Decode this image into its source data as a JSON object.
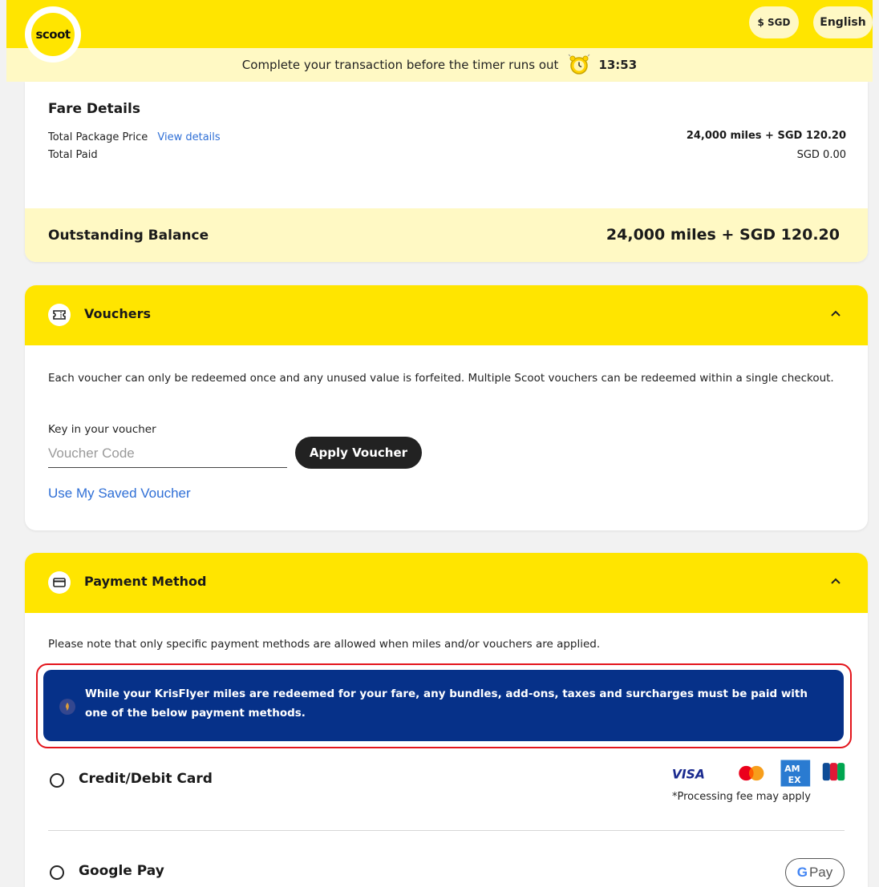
{
  "header": {
    "logo_text": "scoot",
    "currency": "$ SGD",
    "language": "English"
  },
  "timer": {
    "message": "Complete your transaction before the timer runs out",
    "value": "13:53"
  },
  "fare": {
    "title": "Fare Details",
    "package_label": "Total Package Price",
    "view_details": "View details",
    "package_value": "24,000 miles + SGD 120.20",
    "paid_label": "Total Paid",
    "paid_value": "SGD 0.00",
    "balance_label": "Outstanding Balance",
    "balance_value": "24,000 miles + SGD 120.20"
  },
  "vouchers": {
    "title": "Vouchers",
    "note": "Each voucher can only be redeemed once and any unused value is forfeited. Multiple Scoot vouchers can be redeemed within a single checkout.",
    "key_label": "Key in your voucher",
    "input_placeholder": "Voucher Code",
    "input_value": "",
    "apply_label": "Apply Voucher",
    "saved_link": "Use My Saved Voucher"
  },
  "payment": {
    "title": "Payment Method",
    "note": "Please note that only specific payment methods are allowed when miles and/or vouchers are applied.",
    "alert": "While your KrisFlyer miles are redeemed for your fare, any bundles, add-ons, taxes and surcharges must be paid with one of the below payment methods.",
    "options": [
      {
        "label": "Credit/Debit Card",
        "selected": false
      },
      {
        "label": "Google Pay",
        "selected": false
      }
    ],
    "card_brands": [
      "VISA",
      "AM",
      "EX",
      "JCB"
    ],
    "fee_note": "*Processing fee may apply",
    "gpay_badge": {
      "g": "G",
      "pay": "Pay"
    }
  },
  "colors": {
    "brand_yellow": "#ffe500",
    "light_yellow": "#fff9c4",
    "link_blue": "#2f6fd6",
    "alert_navy": "#063189",
    "highlight_red": "#e3141b"
  }
}
